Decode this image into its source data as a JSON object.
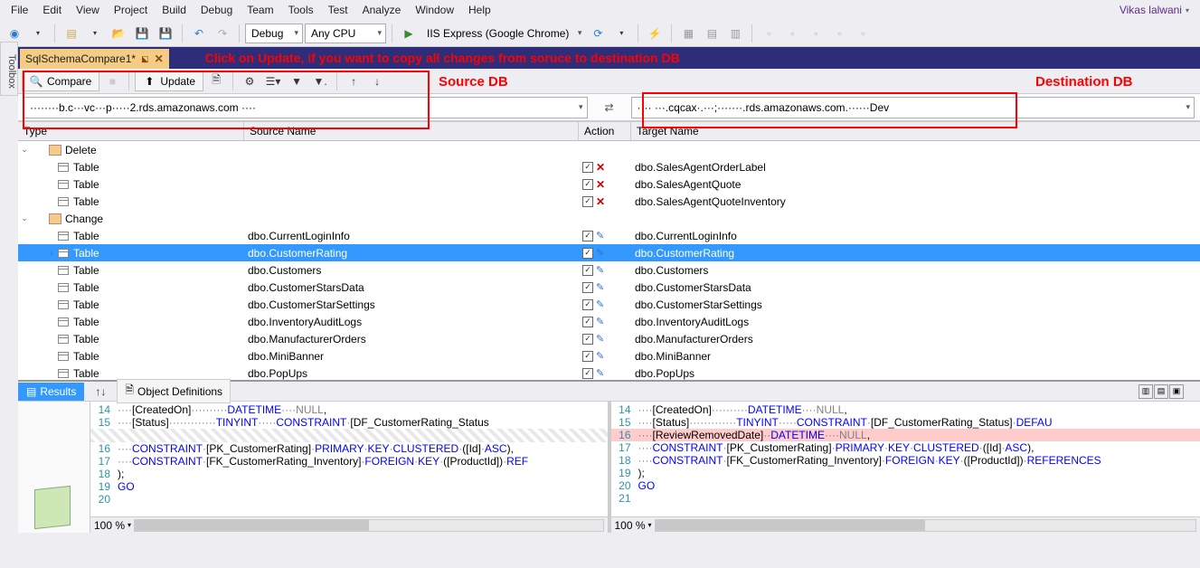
{
  "menu": [
    "File",
    "Edit",
    "View",
    "Project",
    "Build",
    "Debug",
    "Team",
    "Tools",
    "Test",
    "Analyze",
    "Window",
    "Help"
  ],
  "user": "Vikas lalwani",
  "toolbar": {
    "config": "Debug",
    "platform": "Any CPU",
    "run": "IIS Express (Google Chrome)"
  },
  "doc_tab": "SqlSchemaCompare1*",
  "annot": {
    "update": "Click on Update, if you want to copy all changes from soruce to destination DB",
    "src": "Source DB",
    "dst": "Destination DB"
  },
  "compare": {
    "compare_btn": "Compare",
    "update_btn": "Update"
  },
  "db": {
    "source": "········b.c···vc···p·····2.rds.amazonaws.com ····",
    "target": "···· ···.cqcax·.···;·······.rds.amazonaws.com.······Dev"
  },
  "grid": {
    "headers": {
      "type": "Type",
      "src": "Source Name",
      "act": "Action",
      "tgt": "Target Name"
    },
    "groups": [
      {
        "name": "Delete",
        "open": true,
        "action": "del",
        "rows": [
          {
            "type": "Table",
            "src": "",
            "tgt": "dbo.SalesAgentOrderLabel"
          },
          {
            "type": "Table",
            "src": "",
            "tgt": "dbo.SalesAgentQuote"
          },
          {
            "type": "Table",
            "src": "",
            "tgt": "dbo.SalesAgentQuoteInventory"
          }
        ]
      },
      {
        "name": "Change",
        "open": true,
        "action": "edit",
        "rows": [
          {
            "type": "Table",
            "src": "dbo.CurrentLoginInfo",
            "tgt": "dbo.CurrentLoginInfo"
          },
          {
            "type": "Table",
            "src": "dbo.CustomerRating",
            "tgt": "dbo.CustomerRating",
            "selected": true,
            "expandable": true
          },
          {
            "type": "Table",
            "src": "dbo.Customers",
            "tgt": "dbo.Customers"
          },
          {
            "type": "Table",
            "src": "dbo.CustomerStarsData",
            "tgt": "dbo.CustomerStarsData"
          },
          {
            "type": "Table",
            "src": "dbo.CustomerStarSettings",
            "tgt": "dbo.CustomerStarSettings"
          },
          {
            "type": "Table",
            "src": "dbo.InventoryAuditLogs",
            "tgt": "dbo.InventoryAuditLogs"
          },
          {
            "type": "Table",
            "src": "dbo.ManufacturerOrders",
            "tgt": "dbo.ManufacturerOrders"
          },
          {
            "type": "Table",
            "src": "dbo.MiniBanner",
            "tgt": "dbo.MiniBanner"
          },
          {
            "type": "Table",
            "src": "dbo.PopUps",
            "tgt": "dbo.PopUps"
          }
        ]
      }
    ]
  },
  "tabs": {
    "results": "Results",
    "defs": "Object Definitions"
  },
  "zoom": "100 %",
  "left_code": [
    {
      "n": 14,
      "html": "····[CreatedOn]··········<span class='ty'>DATETIME</span>····<span class='nl'>NULL</span>,"
    },
    {
      "n": 15,
      "html": "····[Status]·············<span class='ty'>TINYINT</span>·····<span class='kw'>CONSTRAINT</span>·[DF_CustomerRating_Status"
    },
    {
      "gap": true
    },
    {
      "n": 16,
      "html": "····<span class='kw'>CONSTRAINT</span>·[PK_CustomerRating]·<span class='kw'>PRIMARY</span>·<span class='kw'>KEY</span>·<span class='kw'>CLUSTERED</span>·([Id]·<span class='kw'>ASC</span>),"
    },
    {
      "n": 17,
      "html": "····<span class='kw'>CONSTRAINT</span>·[FK_CustomerRating_Inventory]·<span class='kw'>FOREIGN</span>·<span class='kw'>KEY</span>·([ProductId])·<span class='kw'>REF</span>"
    },
    {
      "n": 18,
      "html": ");"
    },
    {
      "n": 19,
      "html": "<span class='kw'>GO</span>"
    },
    {
      "n": 20,
      "html": ""
    }
  ],
  "right_code": [
    {
      "n": 14,
      "html": "····[CreatedOn]··········<span class='ty'>DATETIME</span>····<span class='nl'>NULL</span>,"
    },
    {
      "n": 15,
      "html": "····[Status]·············<span class='ty'>TINYINT</span>·····<span class='kw'>CONSTRAINT</span>·[DF_CustomerRating_Status]·<span class='kw'>DEFAU</span>"
    },
    {
      "n": 16,
      "html": "····[ReviewRemovedDate]··<span class='ty'>DATETIME</span>····<span class='nl'>NULL</span>,",
      "cls": "diff-add"
    },
    {
      "n": 17,
      "html": "····<span class='kw'>CONSTRAINT</span>·[PK_CustomerRating]·<span class='kw'>PRIMARY</span>·<span class='kw'>KEY</span>·<span class='kw'>CLUSTERED</span>·([Id]·<span class='kw'>ASC</span>),"
    },
    {
      "n": 18,
      "html": "····<span class='kw'>CONSTRAINT</span>·[FK_CustomerRating_Inventory]·<span class='kw'>FOREIGN</span>·<span class='kw'>KEY</span>·([ProductId])·<span class='kw'>REFERENCES</span>"
    },
    {
      "n": 19,
      "html": ");"
    },
    {
      "n": 20,
      "html": "<span class='kw'>GO</span>"
    },
    {
      "n": 21,
      "html": ""
    }
  ]
}
